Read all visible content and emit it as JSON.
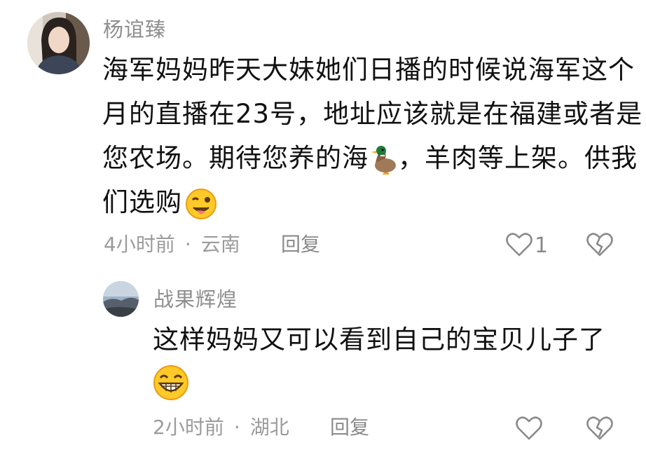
{
  "comments": [
    {
      "username": "杨谊臻",
      "lines": [
        "海军妈妈昨天大妹她们日播的时候说海军这个",
        "月的直播在23号，地址应该就是在福建或者是",
        "您农场。期待您养的海",
        "，羊肉等上架。供我",
        "们选购"
      ],
      "time": "4小时前",
      "location": "云南",
      "reply_label": "回复",
      "like_count": "1",
      "icons": [
        "duck-emoji",
        "wink-tongue-emoji",
        "heart-icon",
        "broken-heart-icon"
      ]
    },
    {
      "username": "战果辉煌",
      "lines": [
        "这样妈妈又可以看到自己的宝贝儿子了"
      ],
      "time": "2小时前",
      "location": "湖北",
      "reply_label": "回复",
      "icons": [
        "grin-emoji",
        "heart-icon",
        "broken-heart-icon"
      ]
    }
  ],
  "separator": "·",
  "colors": {
    "meta": "#9b9b9b",
    "name": "#8f8f8f",
    "text": "#111111"
  }
}
